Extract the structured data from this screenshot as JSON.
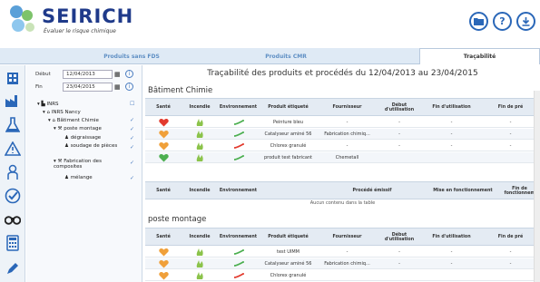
{
  "header": {
    "brand": "SEIRICH",
    "tagline": "Évaluer le risque chimique",
    "folder_icon": "folder-icon",
    "help_label": "?",
    "download_icon": "download-icon"
  },
  "tabs": [
    {
      "label": "Produits sans FDS"
    },
    {
      "label": "Produits CMR"
    },
    {
      "label": "Traçabilité"
    }
  ],
  "rail_icons": [
    "building-icon",
    "factory-icon",
    "flask-icon",
    "warning-icon",
    "worker-icon",
    "check-icon",
    "binoculars-icon",
    "calculator-icon"
  ],
  "filters": {
    "debut_label": "Début",
    "debut_value": "12/04/2013",
    "fin_label": "Fin",
    "fin_value": "23/04/2015"
  },
  "tree": [
    {
      "label": "INRS"
    },
    {
      "label": "INRS Nancy"
    },
    {
      "label": "Bâtiment Chimie"
    },
    {
      "label": "poste montage"
    },
    {
      "label": "dégraissage"
    },
    {
      "label": "soudage de pièces"
    },
    {
      "label": "Fabrication des composites"
    },
    {
      "label": "mélange"
    }
  ],
  "main": {
    "title": "Traçabilité des produits et procédés du 12/04/2013 au 23/04/2015",
    "section1": "Bâtiment Chimie",
    "section2": "poste montage",
    "empty_msg": "Aucun contenu dans la table"
  },
  "columns": {
    "sante": "Santé",
    "incendie": "Incendie",
    "environnement": "Environnement",
    "produit": "Produit étiqueté",
    "fournisseur": "Fournisseur",
    "debut": "Début d'utilisation",
    "fin": "Fin d'utilisation",
    "fin_pre": "Fin de pré",
    "procede": "Procédé émissif",
    "mise": "Mise en fonctionnement",
    "fin_fonc": "Fin de fonctionnem"
  },
  "table1": [
    {
      "produit": "Peinture bleu",
      "fournisseur": "-",
      "debut": "-",
      "fin": "-",
      "finpre": "-",
      "sante": "#e23a2e"
    },
    {
      "produit": "Catalyseur aminé 56",
      "fournisseur": "Fabrication chimiq...",
      "debut": "-",
      "fin": "-",
      "finpre": "-",
      "sante": "#f0a03a"
    },
    {
      "produit": "Chlorex granulé",
      "fournisseur": "-",
      "debut": "-",
      "fin": "-",
      "finpre": "-",
      "sante": "#f0a03a"
    },
    {
      "produit": "produit test fabricant",
      "fournisseur": "Chemetall",
      "debut": "",
      "fin": "",
      "finpre": "",
      "sante": "#4caf50"
    }
  ],
  "table3": [
    {
      "produit": "test UIMM",
      "fournisseur": "-",
      "debut": "-",
      "fin": "-",
      "finpre": "-",
      "sante": "#f0a03a"
    },
    {
      "produit": "Catalyseur aminé 56",
      "fournisseur": "Fabrication chimiq...",
      "debut": "-",
      "fin": "-",
      "finpre": "-",
      "sante": "#f0a03a"
    },
    {
      "produit": "Chlorex granulé",
      "fournisseur": "",
      "debut": "",
      "fin": "",
      "finpre": "",
      "sante": "#f0a03a"
    }
  ]
}
